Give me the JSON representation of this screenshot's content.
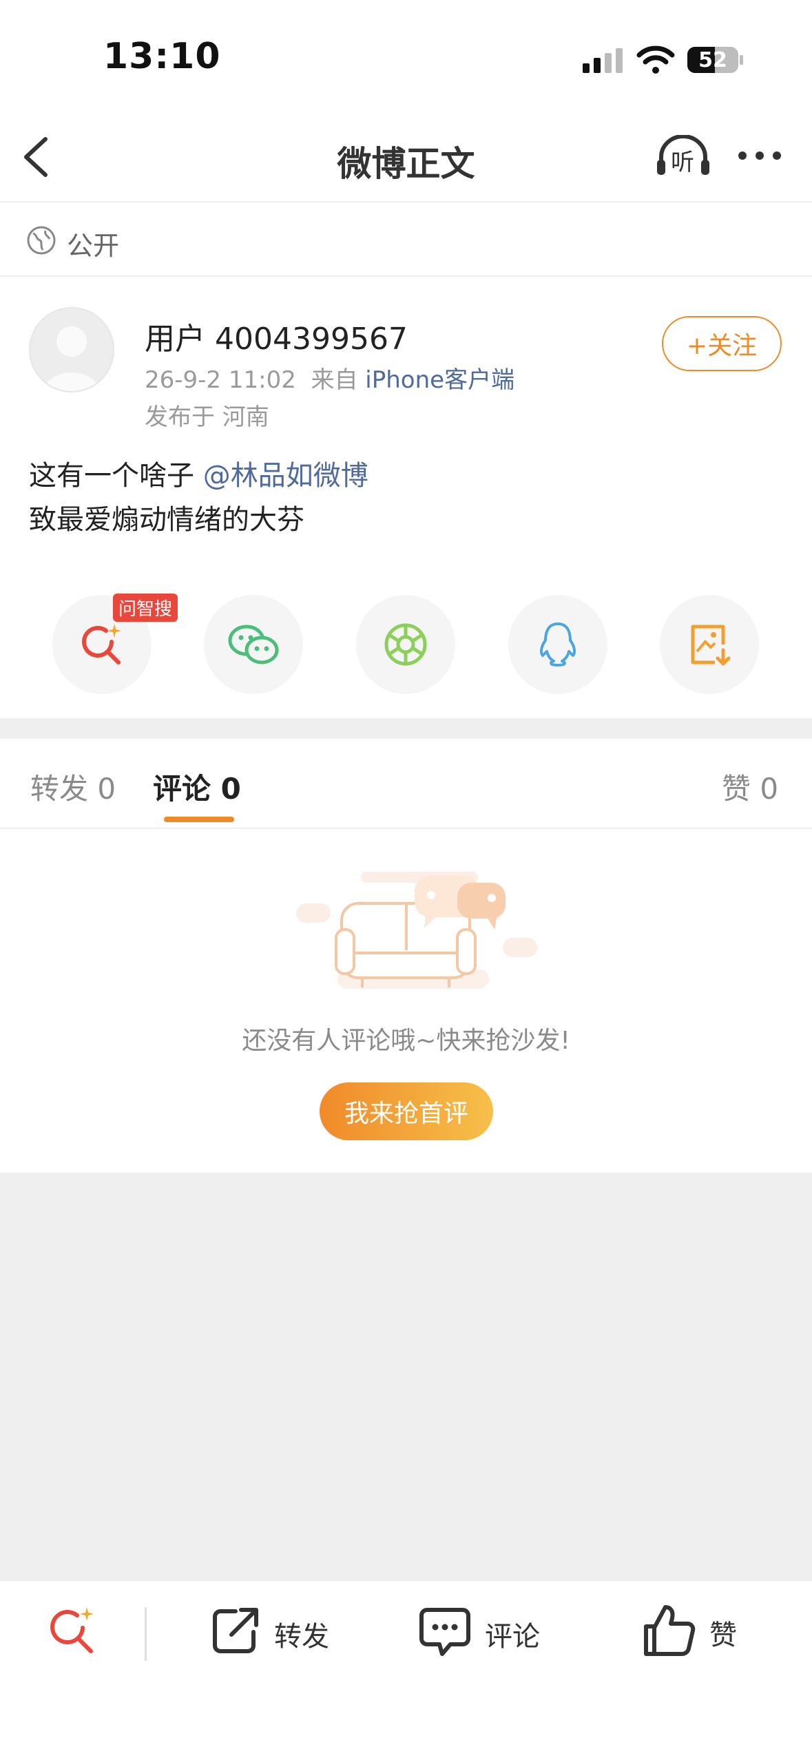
{
  "status_bar": {
    "time": "13:10",
    "battery": "52"
  },
  "header": {
    "title": "微博正文",
    "listen_label": "听"
  },
  "visibility": {
    "label": "公开"
  },
  "author": {
    "name": "用户 4004399567",
    "time": "26-9-2 11:02",
    "source_prefix": "来自",
    "source": "iPhone客户端",
    "location": "发布于 河南",
    "follow_label": "+关注"
  },
  "post": {
    "text_prefix": "这有一个啥子",
    "mention": "@林品如微博",
    "line2": "致最爱煽动情绪的大芬"
  },
  "share": {
    "badge": "问智搜"
  },
  "tabs": {
    "repost": {
      "label": "转发",
      "count": "0"
    },
    "comment": {
      "label": "评论",
      "count": "0"
    },
    "like": {
      "label": "赞",
      "count": "0"
    }
  },
  "empty_state": {
    "text": "还没有人评论哦~快来抢沙发!",
    "button": "我来抢首评"
  },
  "bottom_bar": {
    "repost": "转发",
    "comment": "评论",
    "like": "赞"
  },
  "colors": {
    "accent": "#f08a24",
    "link": "#4e6a9f",
    "wechat": "#4bbf7a",
    "moments": "#8ccf5a",
    "qq": "#4aa6e0",
    "save": "#f0a030",
    "search_red": "#e9463c"
  }
}
